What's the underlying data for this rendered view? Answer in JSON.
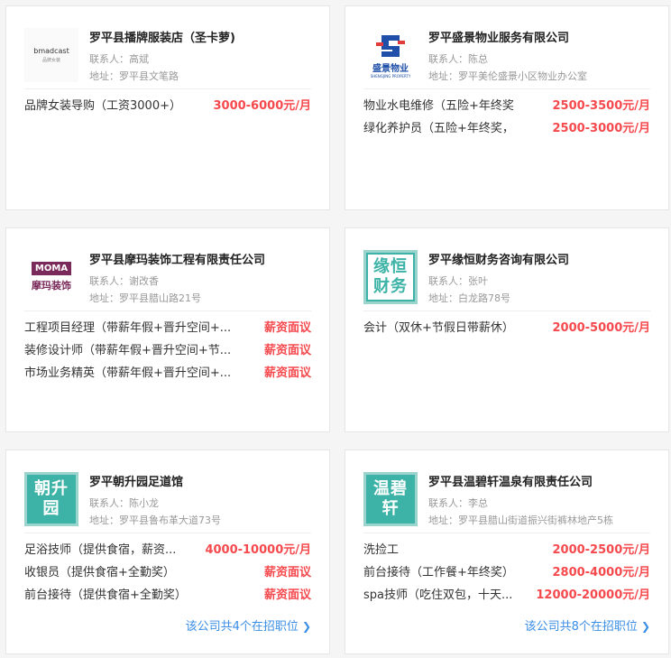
{
  "cards": [
    {
      "company": "罗平县播牌服装店（圣卡萝)",
      "contact_label": "联系人：",
      "contact": "高斌",
      "address_label": "地址：",
      "address": "罗平县文笔路",
      "logo_text": "bmadcast",
      "logo_sub": "品牌女装",
      "jobs": [
        {
          "title": "品牌女装导购（工资3000+）",
          "salary": "3000-6000元/月"
        }
      ]
    },
    {
      "company": "罗平盛景物业服务有限公司",
      "contact_label": "联系人：",
      "contact": "陈总",
      "address_label": "地址：",
      "address": "罗平美伦盛景小区物业办公室",
      "logo_text": "盛景物业",
      "logo_sub": "SHENGJING PROPERTY",
      "jobs": [
        {
          "title": "物业水电维修（五险+年终奖",
          "salary": "2500-3500元/月"
        },
        {
          "title": "绿化养护员（五险+年终奖，",
          "salary": "2500-3000元/月"
        }
      ]
    },
    {
      "company": "罗平县摩玛装饰工程有限责任公司",
      "contact_label": "联系人：",
      "contact": "谢改香",
      "address_label": "地址：",
      "address": "罗平县腊山路21号",
      "logo_text": "摩玛装饰",
      "logo_mark": "MOMA",
      "jobs": [
        {
          "title": "工程项目经理（带薪年假+晋升空间+...",
          "salary": "薪资面议"
        },
        {
          "title": "装修设计师（带薪年假+晋升空间+节...",
          "salary": "薪资面议"
        },
        {
          "title": "市场业务精英（带薪年假+晋升空间+...",
          "salary": "薪资面议"
        }
      ]
    },
    {
      "company": "罗平缘恒财务咨询有限公司",
      "contact_label": "联系人：",
      "contact": "张叶",
      "address_label": "地址：",
      "address": "白龙路78号",
      "logo_line1": "缘恒",
      "logo_line2": "财务",
      "jobs": [
        {
          "title": "会计（双休+节假日带薪休）",
          "salary": "2000-5000元/月"
        }
      ]
    },
    {
      "company": "罗平朝升园足道馆",
      "contact_label": "联系人：",
      "contact": "陈小龙",
      "address_label": "地址：",
      "address": "罗平县鲁布革大道73号",
      "logo_line1": "朝升",
      "logo_line2": "园",
      "jobs": [
        {
          "title": "足浴技师（提供食宿，薪资...",
          "salary": "4000-10000元/月"
        },
        {
          "title": "收银员（提供食宿+全勤奖）",
          "salary": "薪资面议"
        },
        {
          "title": "前台接待（提供食宿+全勤奖）",
          "salary": "薪资面议"
        }
      ],
      "more": "该公司共4个在招职位"
    },
    {
      "company": "罗平县温碧轩温泉有限责任公司",
      "contact_label": "联系人：",
      "contact": "李总",
      "address_label": "地址：",
      "address": "罗平县腊山街道振兴街裤林地产5栋",
      "logo_line1": "温碧",
      "logo_line2": "轩",
      "jobs": [
        {
          "title": "洗捡工",
          "salary": "2000-2500元/月"
        },
        {
          "title": "前台接待（工作餐+年终奖）",
          "salary": "2800-4000元/月"
        },
        {
          "title": "spa技师（吃住双包，十天...",
          "salary": "12000-20000元/月"
        }
      ],
      "more": "该公司共8个在招职位"
    }
  ],
  "colors": {
    "salary": "#f5494d",
    "link": "#3a8ee6",
    "logo_teal": "#3cb3a6"
  },
  "icons": {
    "more_chevron": "chevron-right-icon"
  }
}
